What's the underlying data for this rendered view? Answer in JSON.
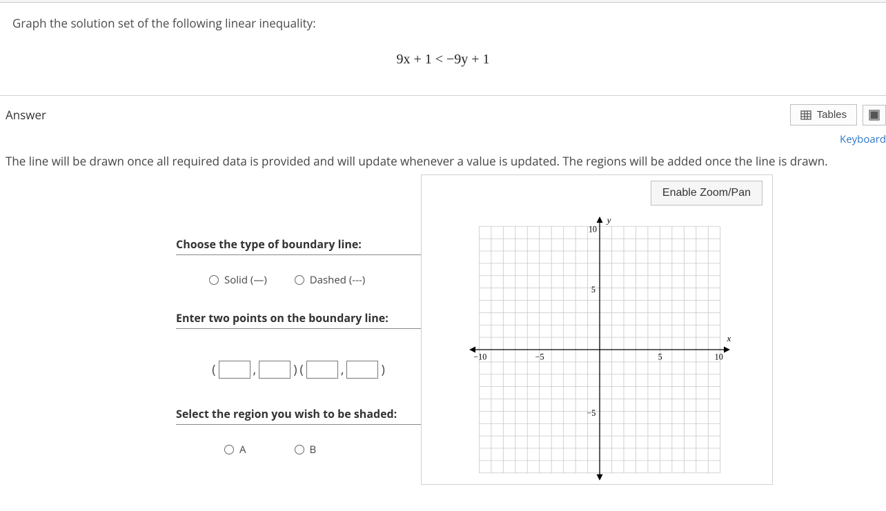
{
  "question": {
    "prompt": "Graph the solution set of the following linear inequality:",
    "equation": "9x + 1 < −9y + 1"
  },
  "answer": {
    "title": "Answer",
    "tables_button": "Tables",
    "keyboard_link": "Keyboard",
    "instructions": "The line will be drawn once all required data is provided and will update whenever a value is updated. The regions will be added once the line is drawn."
  },
  "controls": {
    "boundary_label": "Choose the type of boundary line:",
    "solid_label": "Solid (—)",
    "dashed_label": "Dashed (---)",
    "points_label": "Enter two points on the boundary line:",
    "region_label": "Select the region you wish to be shaded:",
    "region_a": "A",
    "region_b": "B"
  },
  "graph": {
    "zoom_btn": "Enable Zoom/Pan",
    "labels": {
      "y": "y",
      "x": "x",
      "ten": "10",
      "five": "5",
      "neg_five": "−5",
      "neg_ten": "−10"
    }
  },
  "chart_data": {
    "type": "scatter",
    "title": "",
    "xlabel": "x",
    "ylabel": "y",
    "xlim": [
      -10,
      10
    ],
    "ylim": [
      -10,
      10
    ],
    "x_ticks": [
      -10,
      -5,
      5,
      10
    ],
    "y_ticks": [
      -5,
      5,
      10
    ],
    "series": []
  }
}
